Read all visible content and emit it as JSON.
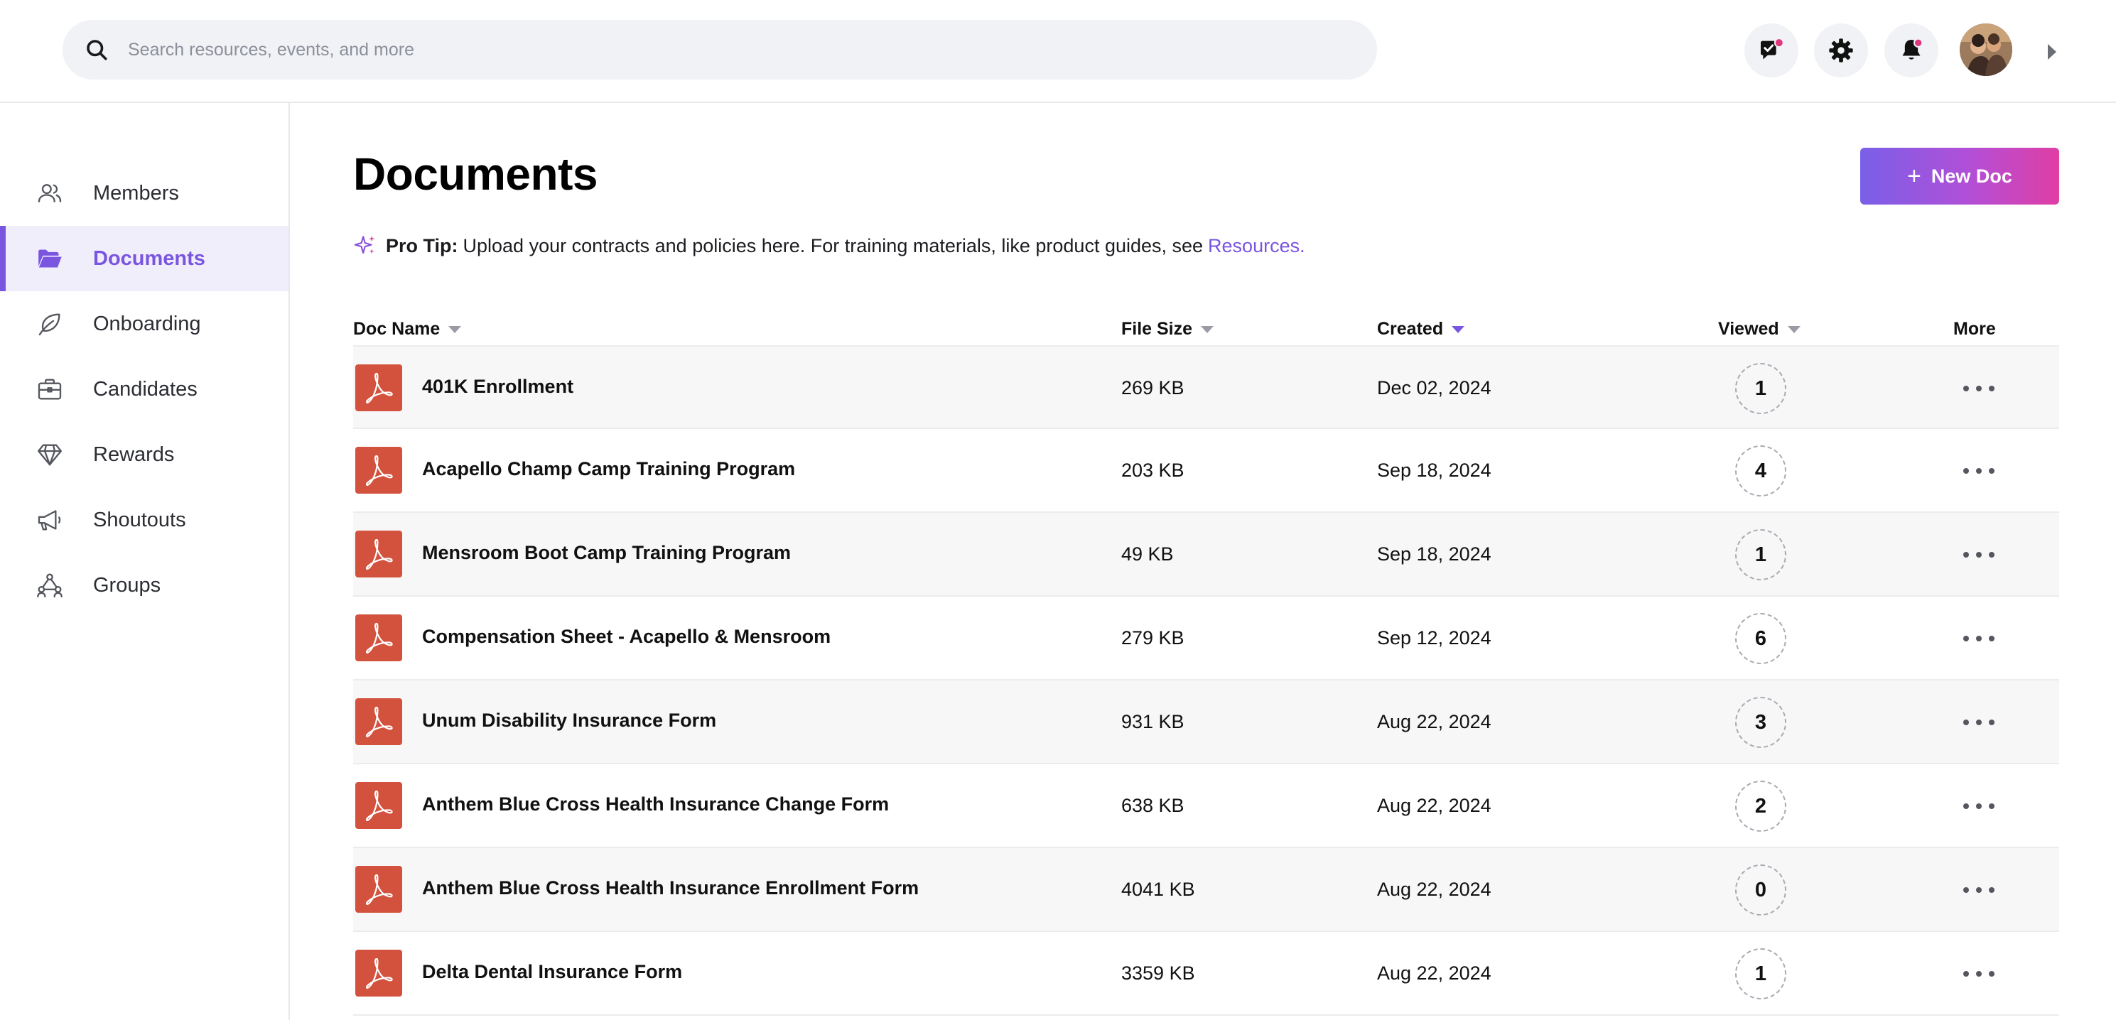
{
  "search": {
    "placeholder": "Search resources, events, and more"
  },
  "header_icons": [
    "chat-notification-icon",
    "gear-icon",
    "bell-icon"
  ],
  "sidebar": {
    "items": [
      {
        "label": "Members",
        "icon": "users-icon",
        "active": false
      },
      {
        "label": "Documents",
        "icon": "folder-open-icon",
        "active": true
      },
      {
        "label": "Onboarding",
        "icon": "leaf-icon",
        "active": false
      },
      {
        "label": "Candidates",
        "icon": "briefcase-icon",
        "active": false
      },
      {
        "label": "Rewards",
        "icon": "diamond-icon",
        "active": false
      },
      {
        "label": "Shoutouts",
        "icon": "megaphone-icon",
        "active": false
      },
      {
        "label": "Groups",
        "icon": "network-icon",
        "active": false
      }
    ]
  },
  "main": {
    "title": "Documents",
    "new_doc_label": "New Doc",
    "tip": {
      "prefix": "Pro Tip:",
      "text": "Upload your contracts and policies here. For training materials, like product guides, see",
      "link": "Resources."
    }
  },
  "table": {
    "columns": {
      "name": "Doc Name",
      "size": "File Size",
      "created": "Created",
      "viewed": "Viewed",
      "more": "More"
    },
    "sorted_by": "Created",
    "rows": [
      {
        "name": "401K Enrollment",
        "size": "269 KB",
        "created": "Dec 02, 2024",
        "viewed": "1"
      },
      {
        "name": "Acapello Champ Camp Training Program",
        "size": "203 KB",
        "created": "Sep 18, 2024",
        "viewed": "4"
      },
      {
        "name": "Mensroom Boot Camp Training Program",
        "size": "49 KB",
        "created": "Sep 18, 2024",
        "viewed": "1"
      },
      {
        "name": "Compensation Sheet - Acapello & Mensroom",
        "size": "279 KB",
        "created": "Sep 12, 2024",
        "viewed": "6"
      },
      {
        "name": "Unum Disability Insurance Form",
        "size": "931 KB",
        "created": "Aug 22, 2024",
        "viewed": "3"
      },
      {
        "name": "Anthem Blue Cross Health Insurance Change Form",
        "size": "638 KB",
        "created": "Aug 22, 2024",
        "viewed": "2"
      },
      {
        "name": "Anthem Blue Cross Health Insurance Enrollment Form",
        "size": "4041 KB",
        "created": "Aug 22, 2024",
        "viewed": "0"
      },
      {
        "name": "Delta Dental Insurance Form",
        "size": "3359 KB",
        "created": "Aug 22, 2024",
        "viewed": "1"
      }
    ]
  },
  "colors": {
    "accent": "#7a55e0",
    "pdf_icon": "#d3523e",
    "button_gradient_start": "#7a5fe8",
    "button_gradient_end": "#e03ea4"
  }
}
